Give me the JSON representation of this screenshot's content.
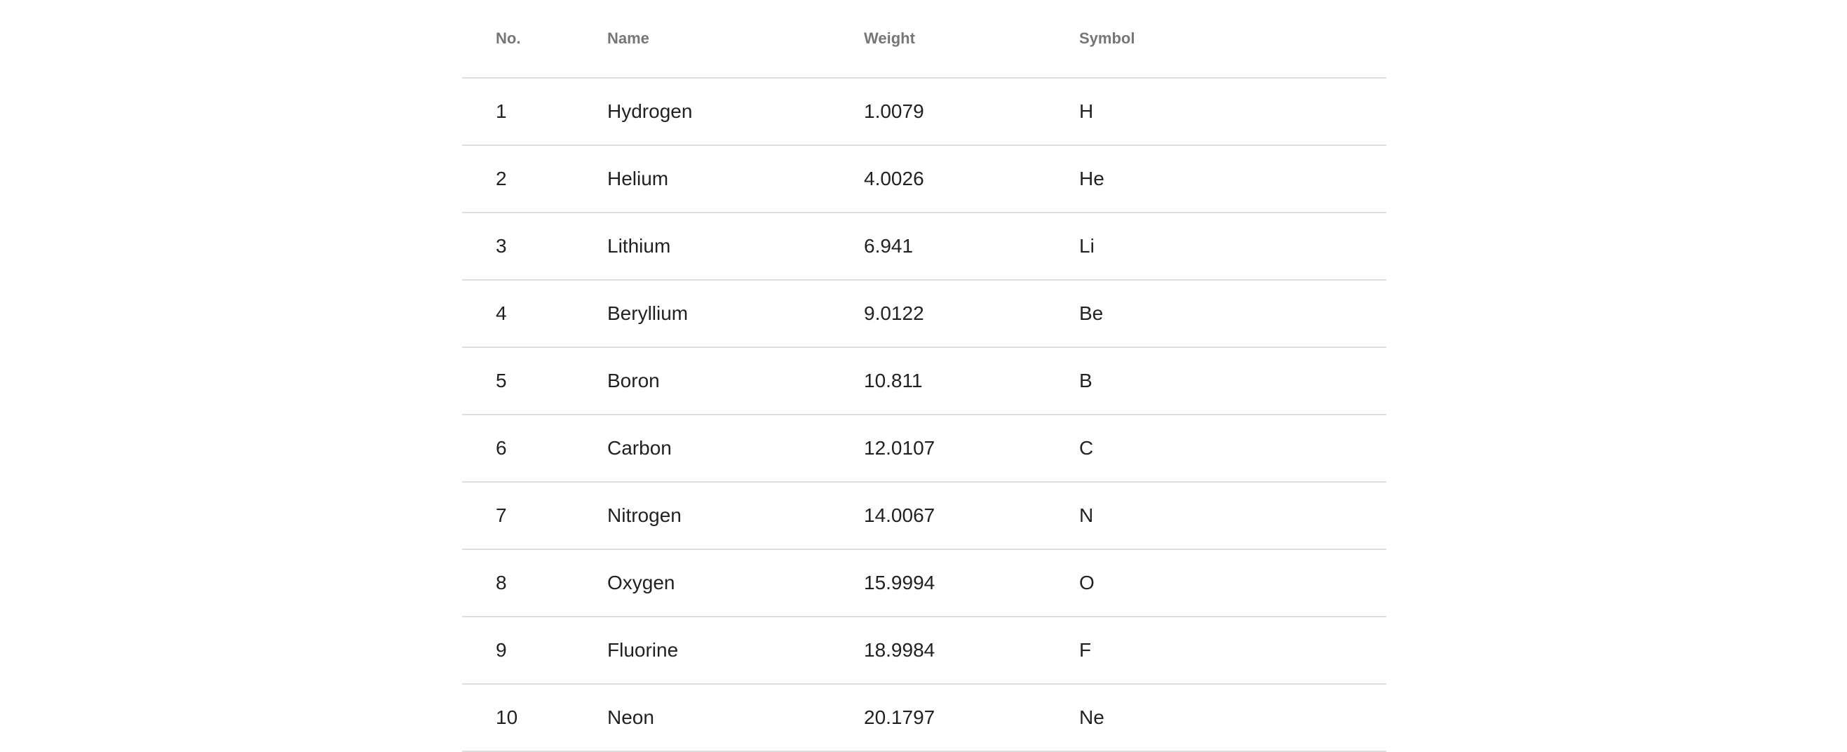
{
  "table": {
    "headers": {
      "no": "No.",
      "name": "Name",
      "weight": "Weight",
      "symbol": "Symbol"
    },
    "rows": [
      {
        "no": "1",
        "name": "Hydrogen",
        "weight": "1.0079",
        "symbol": "H"
      },
      {
        "no": "2",
        "name": "Helium",
        "weight": "4.0026",
        "symbol": "He"
      },
      {
        "no": "3",
        "name": "Lithium",
        "weight": "6.941",
        "symbol": "Li"
      },
      {
        "no": "4",
        "name": "Beryllium",
        "weight": "9.0122",
        "symbol": "Be"
      },
      {
        "no": "5",
        "name": "Boron",
        "weight": "10.811",
        "symbol": "B"
      },
      {
        "no": "6",
        "name": "Carbon",
        "weight": "12.0107",
        "symbol": "C"
      },
      {
        "no": "7",
        "name": "Nitrogen",
        "weight": "14.0067",
        "symbol": "N"
      },
      {
        "no": "8",
        "name": "Oxygen",
        "weight": "15.9994",
        "symbol": "O"
      },
      {
        "no": "9",
        "name": "Fluorine",
        "weight": "18.9984",
        "symbol": "F"
      },
      {
        "no": "10",
        "name": "Neon",
        "weight": "20.1797",
        "symbol": "Ne"
      }
    ]
  }
}
